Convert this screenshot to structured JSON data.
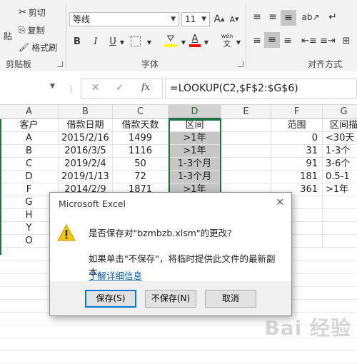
{
  "ribbon": {
    "clipboard": {
      "paste_label": "贴",
      "cut_label": "剪切",
      "copy_label": "复制",
      "format_painter_label": "格式刷",
      "group_label": "剪贴板"
    },
    "font": {
      "font_name": "等线",
      "font_size": "11",
      "grow_font": "A",
      "shrink_font": "A",
      "bold": "B",
      "italic": "I",
      "underline": "U",
      "font_color_letter": "A",
      "phonetic_top": "wén",
      "phonetic_bottom": "文",
      "group_label": "字体"
    },
    "alignment": {
      "group_label": "对齐方式"
    },
    "colors": {
      "fill_accent": "#ffff00",
      "font_accent": "#ff0000",
      "selected_button": "#c5c5c5"
    }
  },
  "formula_bar": {
    "fx": "fx",
    "formula": "=LOOKUP(C2,$F$2:$G$6)"
  },
  "sheet": {
    "columns": [
      "A",
      "B",
      "C",
      "D",
      "E",
      "F",
      "G"
    ],
    "selected_column": "D",
    "rows": [
      [
        "客户",
        "借款日期",
        "借款天数",
        "区间",
        "",
        "范围",
        "区间描"
      ],
      [
        "A",
        "2015/2/16",
        "1499",
        ">1年",
        "",
        "0",
        "<30天"
      ],
      [
        "B",
        "2016/3/5",
        "1116",
        ">1年",
        "",
        "31",
        "1-3个"
      ],
      [
        "C",
        "2019/2/4",
        "50",
        "1-3个月",
        "",
        "91",
        "3-6个"
      ],
      [
        "D",
        "2019/1/13",
        "72",
        "1-3个月",
        "",
        "181",
        "0.5-1"
      ],
      [
        "F",
        "2014/2/9",
        "1871",
        ">1年",
        "",
        "361",
        ">1年"
      ],
      [
        "G",
        "",
        "",
        "",
        "",
        "",
        ""
      ],
      [
        "H",
        "",
        "",
        "",
        "",
        "",
        ""
      ],
      [
        "Y",
        "",
        "",
        "",
        "",
        "",
        ""
      ],
      [
        "O",
        "",
        "",
        "",
        "",
        "",
        ""
      ]
    ]
  },
  "dialog": {
    "title": "Microsoft Excel",
    "close_glyph": "✕",
    "message": "是否保存对\"bzmbzb.xlsm\"的更改?",
    "detail": "如果单击\"不保存\"，将临时提供此文件的最新副本。",
    "link": "了解详细信息",
    "buttons": {
      "save": "保存(S)",
      "dont_save": "不保存(N)",
      "cancel": "取消"
    }
  },
  "watermark": "Bai 经验"
}
